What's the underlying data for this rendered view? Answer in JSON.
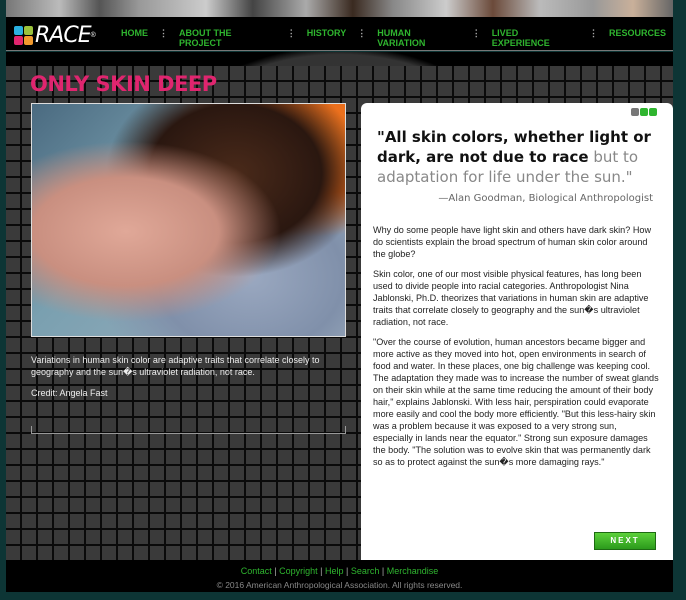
{
  "header": {
    "logo": "RACE",
    "nav": [
      "HOME",
      "ABOUT THE PROJECT",
      "HISTORY",
      "HUMAN VARIATION",
      "LIVED EXPERIENCE",
      "RESOURCES"
    ]
  },
  "page": {
    "title": "ONLY SKIN DEEP",
    "caption": "Variations in human skin color are adaptive traits that correlate closely to geography and the sun�s ultraviolet radiation, not race.",
    "credit": "Credit: Angela Fast",
    "quote_dark": "\"All skin colors, whether light or dark, are not due to race",
    "quote_light": " but to adaptation for life under the sun.\"",
    "attribution": "—Alan Goodman, Biological Anthropologist",
    "paragraphs": [
      "Why do some people have light skin and others have dark skin? How do scientists explain the broad spectrum of human skin color around the globe?",
      "Skin color, one of our most visible physical features, has long been used to divide people into racial categories. Anthropologist Nina Jablonski, Ph.D. theorizes that variations in human skin are adaptive traits that correlate closely to geography and the sun�s ultraviolet radiation, not race.",
      "\"Over the course of evolution, human ancestors became bigger and more active as they moved into hot, open environments in search of food and water. In these places, one big challenge was keeping cool. The adaptation they made was to increase the number of sweat glands on their skin while at the same time reducing the amount of their body hair,\" explains Jablonski. With less hair, perspiration could evaporate more easily and cool the body more efficiently. \"But this less-hairy skin was a problem because it was exposed to a very strong sun, especially in lands near the equator.\" Strong sun exposure damages the body. \"The solution was to evolve skin that was permanently dark so as to protect against the sun�s more damaging rays.\""
    ],
    "next": "NEXT"
  },
  "footer": {
    "links": [
      "Contact",
      "Copyright",
      "Help",
      "Search",
      "Merchandise"
    ],
    "copyright": "© 2016 American Anthropological Association. All rights reserved."
  },
  "colors": {
    "accent": "#2fb52f",
    "title": "#e0256f"
  }
}
